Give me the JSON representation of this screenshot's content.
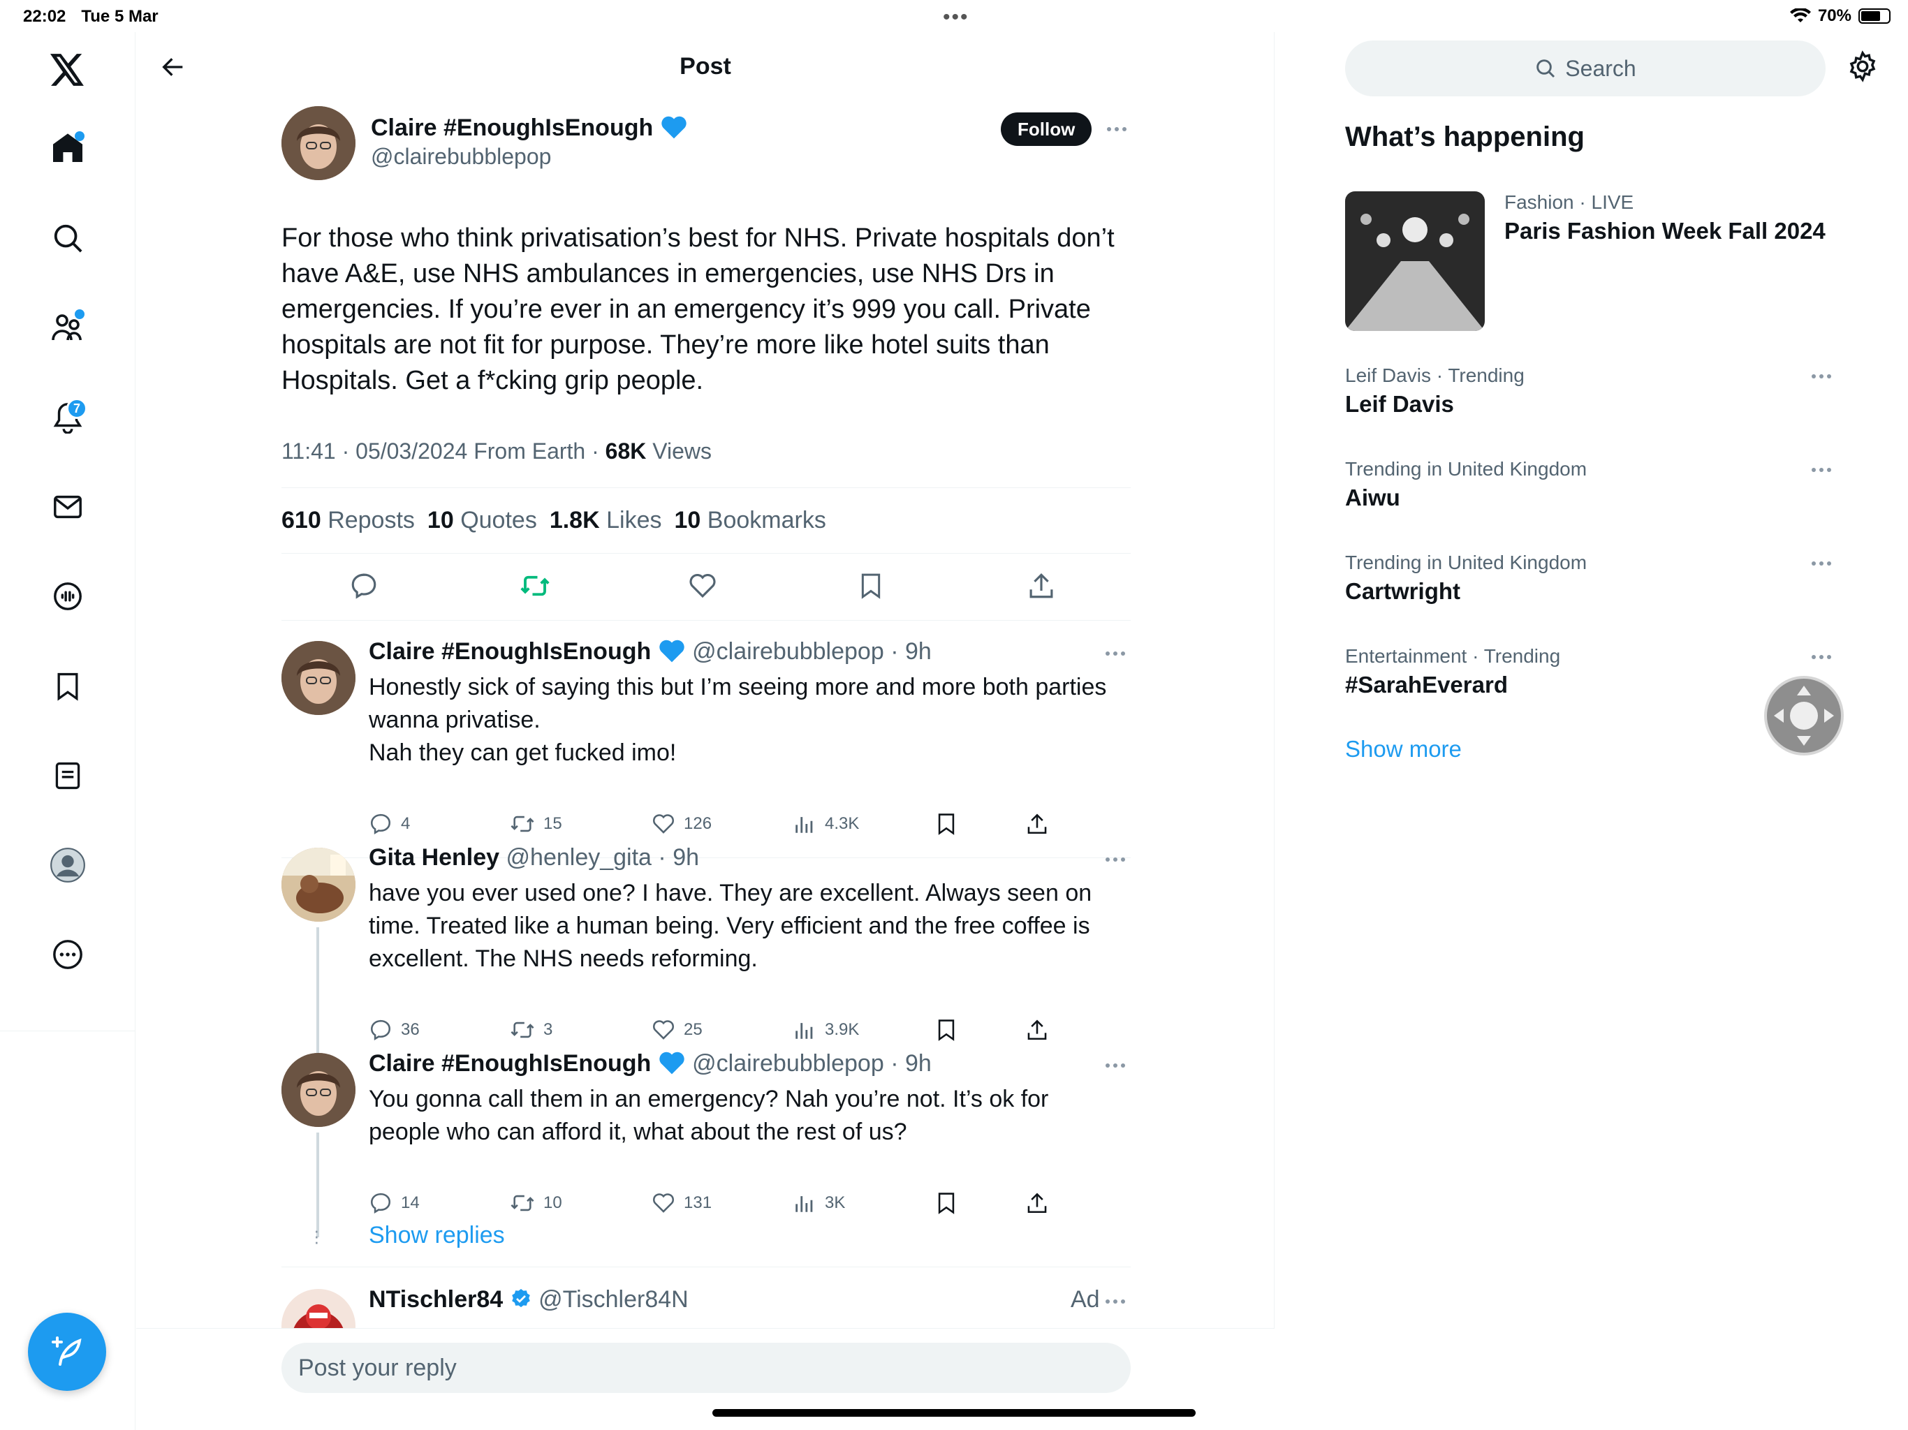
{
  "status_bar": {
    "time": "22:02",
    "date": "Tue 5 Mar",
    "battery": "70%",
    "battery_level": 0.7
  },
  "nav": {
    "items": [
      {
        "name": "x-logo-icon"
      },
      {
        "name": "home-icon"
      },
      {
        "name": "search-icon"
      },
      {
        "name": "communities-icon"
      },
      {
        "name": "notifications-icon",
        "badge": "7"
      },
      {
        "name": "messages-icon"
      },
      {
        "name": "spaces-icon"
      },
      {
        "name": "bookmarks-icon"
      },
      {
        "name": "lists-icon"
      },
      {
        "name": "profile-icon"
      },
      {
        "name": "more-icon"
      }
    ],
    "compose_icon": "compose-icon"
  },
  "header": {
    "title": "Post"
  },
  "main_post": {
    "author": "Claire #EnoughIsEnough",
    "handle": "@clairebubblepop",
    "follow_label": "Follow",
    "text": "For those who think privatisation’s best for NHS. Private hospitals don’t have A&E, use NHS ambulances in emergencies, use NHS Drs in emergencies. If you’re ever in an emergency it’s 999 you call. Private hospitals are not fit for purpose. They’re more like hotel suits than Hospitals. Get a f*cking grip people.",
    "meta": "11:41 · 05/03/2024 From Earth · ",
    "views_count": "68K",
    "views_label": "Views",
    "stats": [
      {
        "count": "610",
        "label": "Reposts"
      },
      {
        "count": "10",
        "label": "Quotes"
      },
      {
        "count": "1.8K",
        "label": "Likes"
      },
      {
        "count": "10",
        "label": "Bookmarks"
      }
    ]
  },
  "replies": [
    {
      "author": "Claire #EnoughIsEnough",
      "handle": "@clairebubblepop",
      "time": "· 9h",
      "lines": [
        "Honestly sick of saying this but I’m seeing more and more both parties wanna privatise.",
        "Nah they can get fucked imo!"
      ],
      "replies": "4",
      "reposts": "15",
      "likes": "126",
      "views": "4.3K"
    },
    {
      "author": "Gita Henley",
      "handle": "@henley_gita",
      "time": "· 9h",
      "lines": [
        "have you ever used one? I have. They are excellent. Always seen on time. Treated like a human being. Very efficient and the free coffee is excellent. The NHS needs reforming."
      ],
      "replies": "36",
      "reposts": "3",
      "likes": "25",
      "views": "3.9K"
    },
    {
      "author": "Claire #EnoughIsEnough",
      "handle": "@clairebubblepop",
      "time": "· 9h",
      "lines": [
        "You gonna call them in an emergency? Nah you’re not. It’s ok for people who can afford it, what about the rest of us?"
      ],
      "replies": "14",
      "reposts": "10",
      "likes": "131",
      "views": "3K"
    }
  ],
  "show_replies": "Show replies",
  "ad": {
    "author": "NTischler84",
    "handle": "@Tischler84N",
    "label": "Ad"
  },
  "reply_box": {
    "placeholder": "Post your reply"
  },
  "sidebar": {
    "search_placeholder": "Search",
    "heading": "What’s happening",
    "featured": {
      "category": "Fashion",
      "live": "· LIVE",
      "title": "Paris Fashion Week Fall 2024"
    },
    "trends": [
      {
        "category": "Leif Davis · Trending",
        "title": "Leif Davis"
      },
      {
        "category": "Trending in United Kingdom",
        "title": "Aiwu"
      },
      {
        "category": "Trending in United Kingdom",
        "title": "Cartwright"
      },
      {
        "category": "Entertainment · Trending",
        "title": "#SarahEverard"
      }
    ],
    "show_more": "Show more"
  },
  "colors": {
    "accent": "#1d9bf0",
    "repost_active": "#00ba7c",
    "text": "#0f1419",
    "muted": "#536471"
  }
}
